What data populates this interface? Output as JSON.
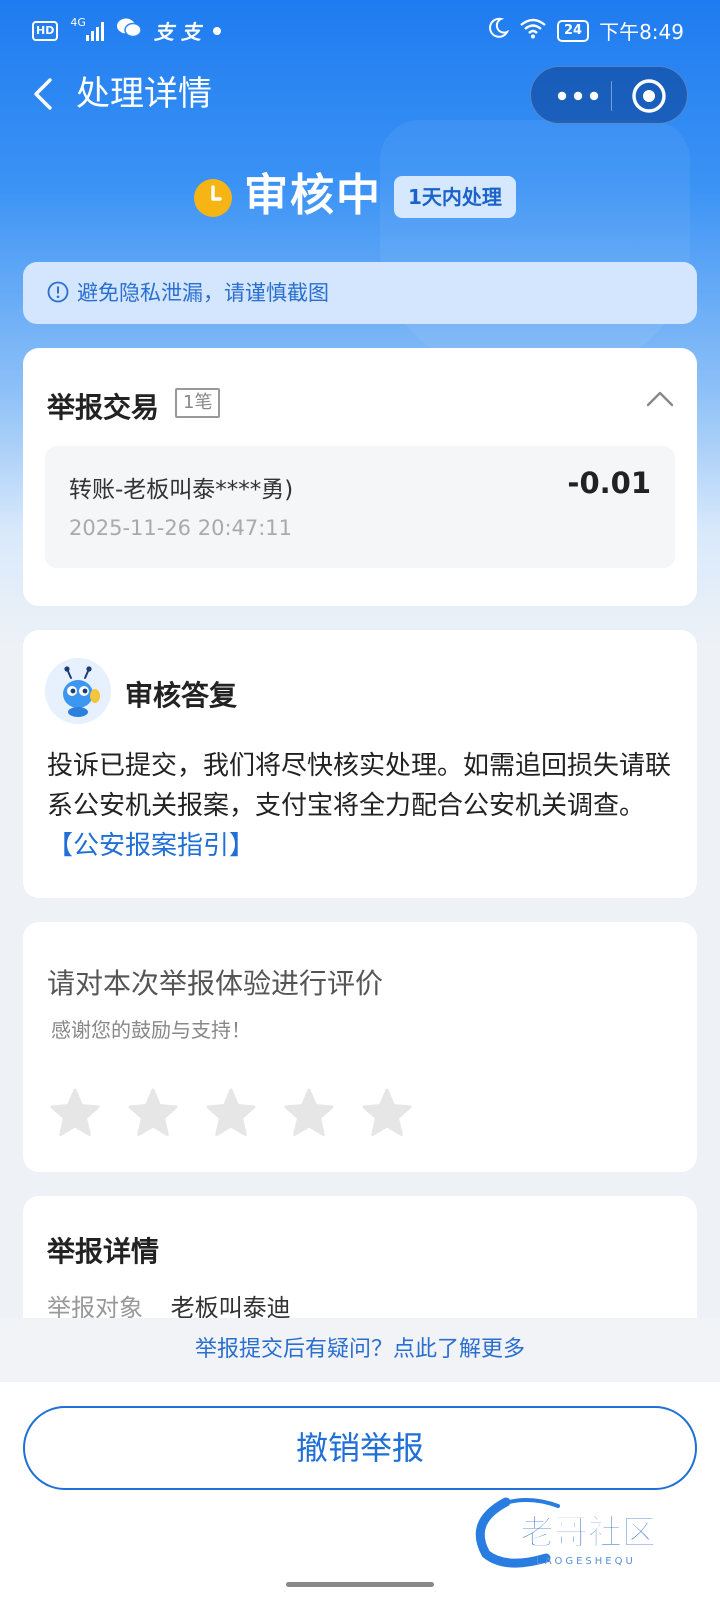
{
  "status_bar": {
    "hd": "HD",
    "network": "4G",
    "carrier_icons": "支 支",
    "battery": "24",
    "time": "下午8:49"
  },
  "nav": {
    "title": "处理详情"
  },
  "status": {
    "title": "审核中",
    "badge": "1天内处理"
  },
  "notice": {
    "text": "避免隐私泄漏，请谨慎截图"
  },
  "transaction": {
    "title": "举报交易",
    "count": "1笔",
    "items": [
      {
        "name": "转账-老板叫泰****勇)",
        "amount": "-0.01",
        "time": "2025-11-26 20:47:11"
      }
    ]
  },
  "reply": {
    "title": "审核答复",
    "body": "投诉已提交，我们将尽快核实处理。如需追回损失请联系公安机关报案，支付宝将全力配合公安机关调查。",
    "link": "【公安报案指引】"
  },
  "rating": {
    "title": "请对本次举报体验进行评价",
    "subtitle": "感谢您的鼓励与支持！",
    "stars_total": 5,
    "stars_selected": 0
  },
  "detail": {
    "title": "举报详情",
    "target_label": "举报对象",
    "target_value": "老板叫泰迪"
  },
  "help": {
    "text": "举报提交后有疑问？点此了解更多"
  },
  "actions": {
    "cancel_label": "撤销举报"
  },
  "watermark": {
    "text": "老哥社区",
    "sub": "LAOGESHEQU"
  },
  "colors": {
    "brand_blue": "#1f7cf0",
    "link_blue": "#1f6fd6",
    "badge_bg": "#d6e8fd",
    "clock_yellow": "#f6b515"
  }
}
